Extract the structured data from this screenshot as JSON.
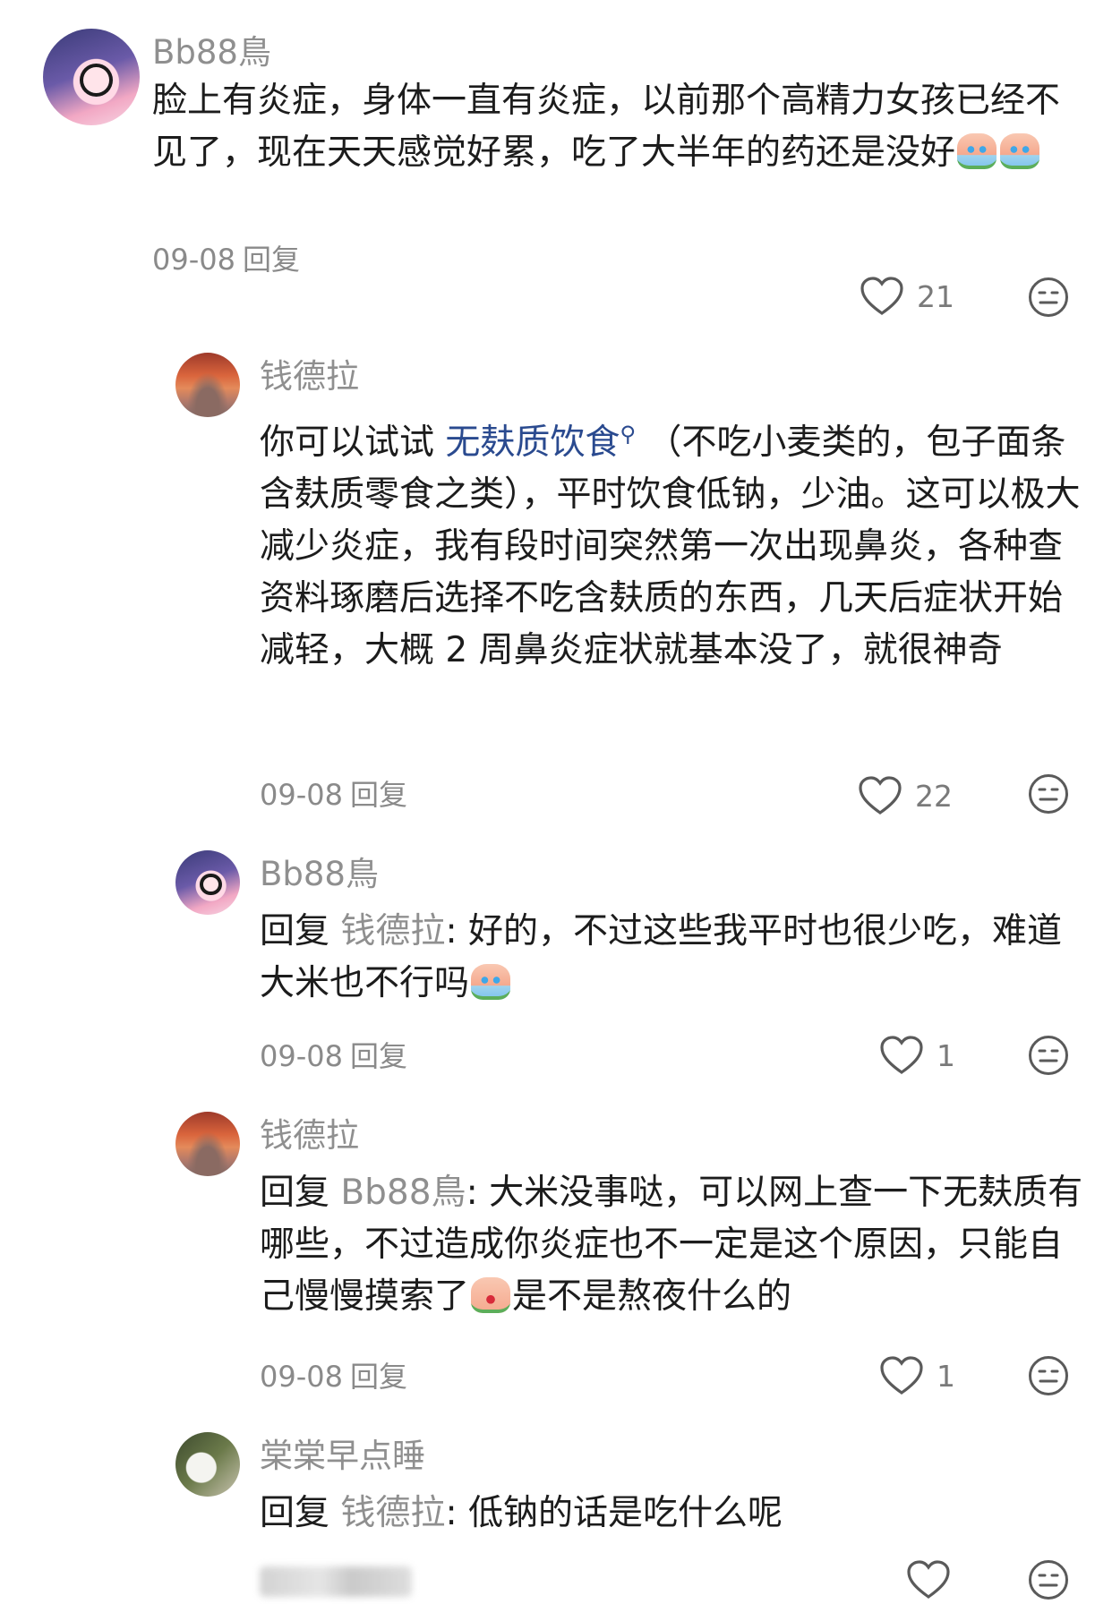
{
  "comments": [
    {
      "author": "Bb88鳥",
      "text": "脸上有炎症，身体一直有炎症，以前那个高精力女孩已经不见了，现在天天感觉好累，吃了大半年的药还是没好",
      "date": "09-08",
      "reply_label": "回复",
      "likes": "21",
      "avatar": "girl-avatar"
    },
    {
      "author": "钱德拉",
      "text_before_link": "你可以试试 ",
      "link_text": "无麸质饮食",
      "text_after_link": " （不吃小麦类的，包子面条含麸质零食之类），平时饮食低钠，少油。这可以极大减少炎症，我有段时间突然第一次出现鼻炎，各种查资料琢磨后选择不吃含麸质的东西，几天后症状开始减轻，大概 2 周鼻炎症状就基本没了，就很神奇",
      "date": "09-08",
      "reply_label": "回复",
      "likes": "22",
      "avatar": "sunset-avatar"
    },
    {
      "author": "Bb88鳥",
      "reply_prefix": "回复",
      "reply_target": "钱德拉",
      "text": ": 好的，不过这些我平时也很少吃，难道大米也不行吗",
      "date": "09-08",
      "reply_label": "回复",
      "likes": "1",
      "avatar": "girl-avatar"
    },
    {
      "author": "钱德拉",
      "reply_prefix": "回复",
      "reply_target": "Bb88鳥",
      "text": ": 大米没事哒，可以网上查一下无麸质有哪些，不过造成你炎症也不一定是这个原因，只能自己慢慢摸索了",
      "text_tail": "是不是熬夜什么的",
      "date": "09-08",
      "reply_label": "回复",
      "likes": "1",
      "avatar": "sunset-avatar"
    },
    {
      "author": "棠棠早点睡",
      "reply_prefix": "回复",
      "reply_target": "钱德拉",
      "text": ": 低钠的话是吃什么呢",
      "avatar": "panda-avatar"
    }
  ],
  "icons": {
    "like": "heart-outline-icon",
    "dislike": "meh-face-icon"
  },
  "colors": {
    "author": "#8f8f8f",
    "link": "#2a4a8f",
    "meta": "#8a8a8a"
  }
}
